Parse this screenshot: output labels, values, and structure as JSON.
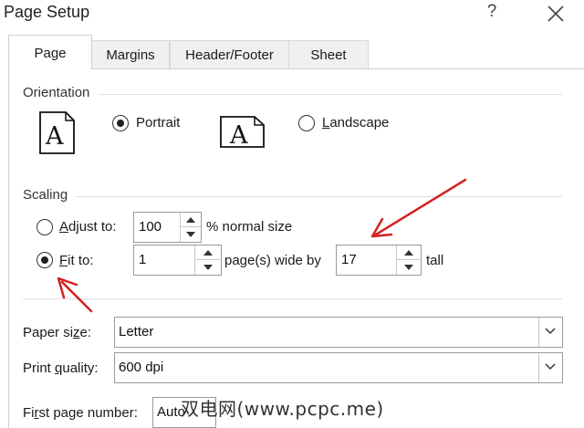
{
  "window": {
    "title": "Page Setup",
    "help": "?",
    "close_icon": "close-icon"
  },
  "tabs": [
    {
      "label": "Page",
      "active": true
    },
    {
      "label": "Margins",
      "active": false
    },
    {
      "label": "Header/Footer",
      "active": false
    },
    {
      "label": "Sheet",
      "active": false
    }
  ],
  "orientation": {
    "heading": "Orientation",
    "portrait": {
      "label": "Portrait",
      "selected": true,
      "icon": "portrait-page-icon",
      "glyph": "A"
    },
    "landscape": {
      "label": "Landscape",
      "selected": false,
      "icon": "landscape-page-icon",
      "glyph": "A"
    }
  },
  "scaling": {
    "heading": "Scaling",
    "adjust": {
      "label": "Adjust to:",
      "value": "100",
      "suffix": "% normal size",
      "selected": false
    },
    "fit": {
      "label": "Fit to:",
      "wide_value": "1",
      "wide_suffix": "page(s) wide by",
      "tall_value": "17",
      "tall_suffix": "tall",
      "selected": true
    }
  },
  "paper_size": {
    "label": "Paper size:",
    "value": "Letter"
  },
  "print_quality": {
    "label": "Print quality:",
    "value": "600 dpi"
  },
  "first_page_number": {
    "label": "First page number:",
    "value": "Auto"
  },
  "watermark": "双电网(www.pcpc.me)",
  "colors": {
    "annotation_arrow": "#d42020"
  }
}
